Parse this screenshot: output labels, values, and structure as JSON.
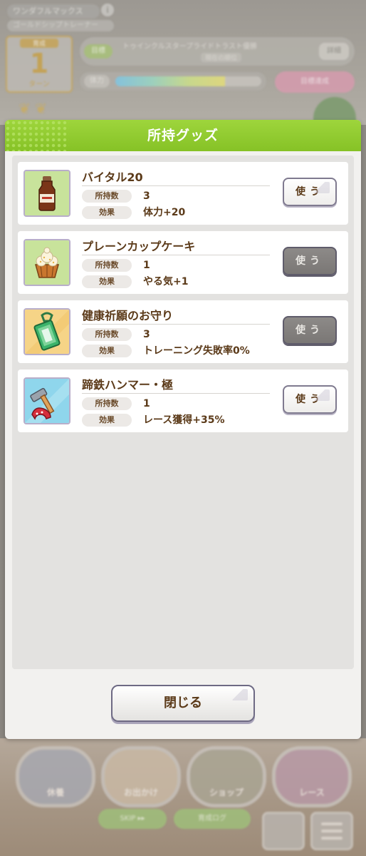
{
  "background": {
    "trainee_name": "ワンダフルマックス",
    "subtitle": "ゴールドシップトレーナー",
    "turn_label": "育成",
    "turn_number": "1",
    "turn_unit": "ターン",
    "goal_tag": "目標",
    "goal_text": "トゥインクルスタープライドトラスト優勝",
    "goal_sub": "現在の順位",
    "goal_button": "詳細",
    "energy_label": "体力",
    "energy_level": 0.75,
    "event_button": "目標達成",
    "bottom_buttons": [
      "休養",
      "お出かけ",
      "ショップ",
      "レース"
    ],
    "skip_label": "SKIP ▸▸",
    "log_label": "育成ログ"
  },
  "modal": {
    "title": "所持グッズ",
    "rows": [
      {
        "label": "所持数"
      },
      {
        "label": "効果"
      }
    ],
    "items": [
      {
        "name": "バイタル20",
        "count": "3",
        "effect": "体力+20",
        "button": "使う",
        "usable": true,
        "icon": "energy-drink-icon"
      },
      {
        "name": "プレーンカップケーキ",
        "count": "1",
        "effect": "やる気+1",
        "button": "使う",
        "usable": false,
        "icon": "cupcake-icon"
      },
      {
        "name": "健康祈願のお守り",
        "count": "3",
        "effect": "トレーニング失敗率0%",
        "button": "使う",
        "usable": false,
        "icon": "charm-icon"
      },
      {
        "name": "蹄鉄ハンマー・極",
        "count": "1",
        "effect": "レース獲得+35%",
        "button": "使う",
        "usable": true,
        "icon": "hammer-icon"
      }
    ],
    "close_label": "閉じる"
  },
  "colors": {
    "header_green": "#8cc62a",
    "text_brown": "#5b3a19",
    "button_disabled": "#7f7c7a"
  }
}
